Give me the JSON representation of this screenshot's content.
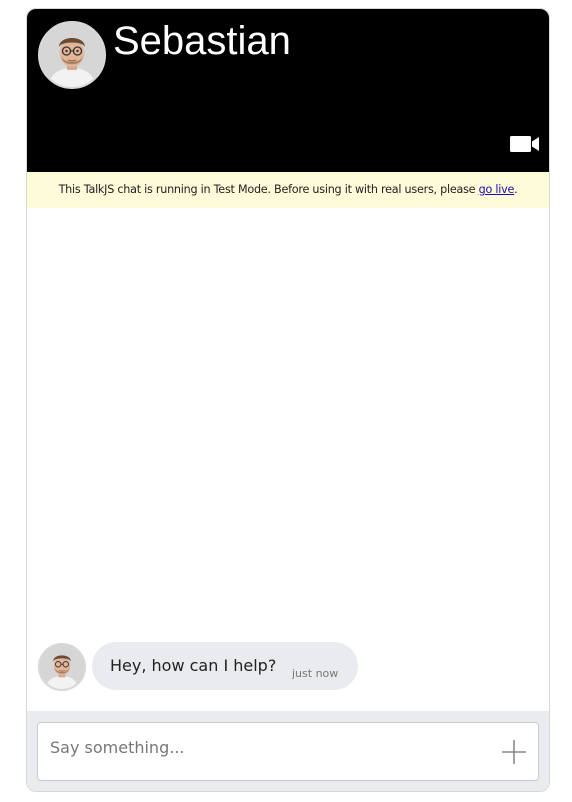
{
  "header": {
    "name": "Sebastian",
    "avatar_icon": "user-avatar-photo",
    "video_icon": "video-camera-icon"
  },
  "banner": {
    "text": "This TalkJS chat is running in Test Mode. Before using it with real users, please ",
    "link_label": "go live",
    "suffix": ".",
    "background": "#fefbd9"
  },
  "messages": [
    {
      "text": "Hey, how can I help?",
      "time": "just now",
      "avatar_icon": "user-avatar-photo"
    }
  ],
  "composer": {
    "placeholder": "Say something...",
    "value": "",
    "add_icon": "plus-icon"
  },
  "colors": {
    "header_bg": "#000000",
    "bubble_bg": "#e9ebee",
    "footer_bg": "#e9ebee",
    "link": "#1a0dab"
  }
}
